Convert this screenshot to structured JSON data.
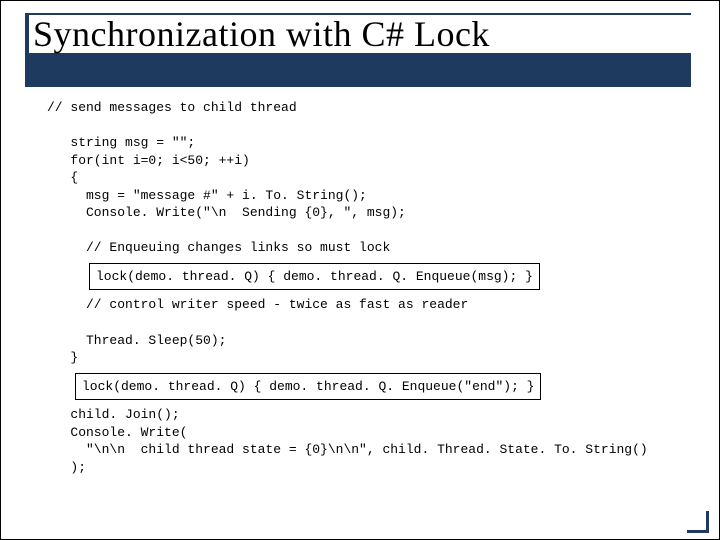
{
  "title": "Synchronization with C# Lock",
  "code": {
    "c0": "// send messages to child thread",
    "c1": "   string msg = \"\";",
    "c2": "   for(int i=0; i<50; ++i)",
    "c3": "   {",
    "c4": "     msg = \"message #\" + i. To. String();",
    "c5": "     Console. Write(\"\\n  Sending {0}, \", msg);",
    "c6": "     // Enqueuing changes links so must lock",
    "box1": "lock(demo. thread. Q) { demo. thread. Q. Enqueue(msg); }",
    "c7": "     // control writer speed - twice as fast as reader",
    "c8": "     Thread. Sleep(50);",
    "c9": "   }",
    "box2": "lock(demo. thread. Q)  { demo. thread. Q. Enqueue(\"end\"); }",
    "c10": "   child. Join();",
    "c11": "   Console. Write(",
    "c12": "     \"\\n\\n  child thread state = {0}\\n\\n\", child. Thread. State. To. String()",
    "c13": "   );"
  }
}
